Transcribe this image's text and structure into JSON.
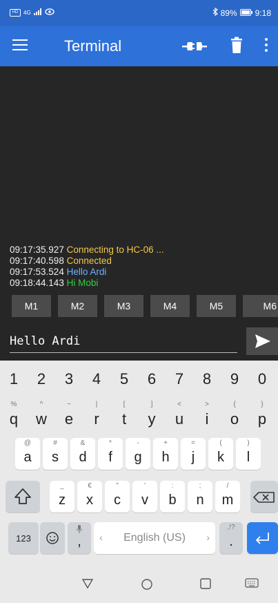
{
  "status_bar": {
    "left_badge": "HD",
    "network": "4G",
    "battery": "89%",
    "time": "9:18"
  },
  "app_bar": {
    "title": "Terminal"
  },
  "terminal": {
    "lines": [
      {
        "time": "09:17:35.927",
        "text": "Connecting to HC-06 ...",
        "color": "#f2c94c"
      },
      {
        "time": "09:17:40.598",
        "text": "Connected",
        "color": "#f2c94c"
      },
      {
        "time": "09:17:53.524",
        "text": "Hello Ardi",
        "color": "#6fb2ff"
      },
      {
        "time": "09:18:44.143",
        "text": "Hi Mobi",
        "color": "#30d040"
      }
    ]
  },
  "macros": [
    "M1",
    "M2",
    "M3",
    "M4",
    "M5",
    "M6"
  ],
  "input": {
    "value": "Hello Ardi"
  },
  "keyboard": {
    "numbers": [
      "1",
      "2",
      "3",
      "4",
      "5",
      "6",
      "7",
      "8",
      "9",
      "0"
    ],
    "row1": [
      {
        "main": "q",
        "sub": "%"
      },
      {
        "main": "w",
        "sub": "^"
      },
      {
        "main": "e",
        "sub": "~"
      },
      {
        "main": "r",
        "sub": "|"
      },
      {
        "main": "t",
        "sub": "["
      },
      {
        "main": "y",
        "sub": "]"
      },
      {
        "main": "u",
        "sub": "<"
      },
      {
        "main": "i",
        "sub": ">"
      },
      {
        "main": "o",
        "sub": "{"
      },
      {
        "main": "p",
        "sub": "}"
      }
    ],
    "row2": [
      {
        "main": "a",
        "sub": "@"
      },
      {
        "main": "s",
        "sub": "#"
      },
      {
        "main": "d",
        "sub": "&"
      },
      {
        "main": "f",
        "sub": "*"
      },
      {
        "main": "g",
        "sub": "-"
      },
      {
        "main": "h",
        "sub": "+"
      },
      {
        "main": "j",
        "sub": "="
      },
      {
        "main": "k",
        "sub": "("
      },
      {
        "main": "l",
        "sub": ")"
      }
    ],
    "row3": [
      {
        "main": "z",
        "sub": "_"
      },
      {
        "main": "x",
        "sub": "€"
      },
      {
        "main": "c",
        "sub": "\""
      },
      {
        "main": "v",
        "sub": "'"
      },
      {
        "main": "b",
        "sub": ":"
      },
      {
        "main": "n",
        "sub": ";"
      },
      {
        "main": "m",
        "sub": "/"
      }
    ],
    "numeric_toggle": "123",
    "comma": ",",
    "period": ".",
    "period_sub": ",!?",
    "space_label": "English (US)"
  }
}
